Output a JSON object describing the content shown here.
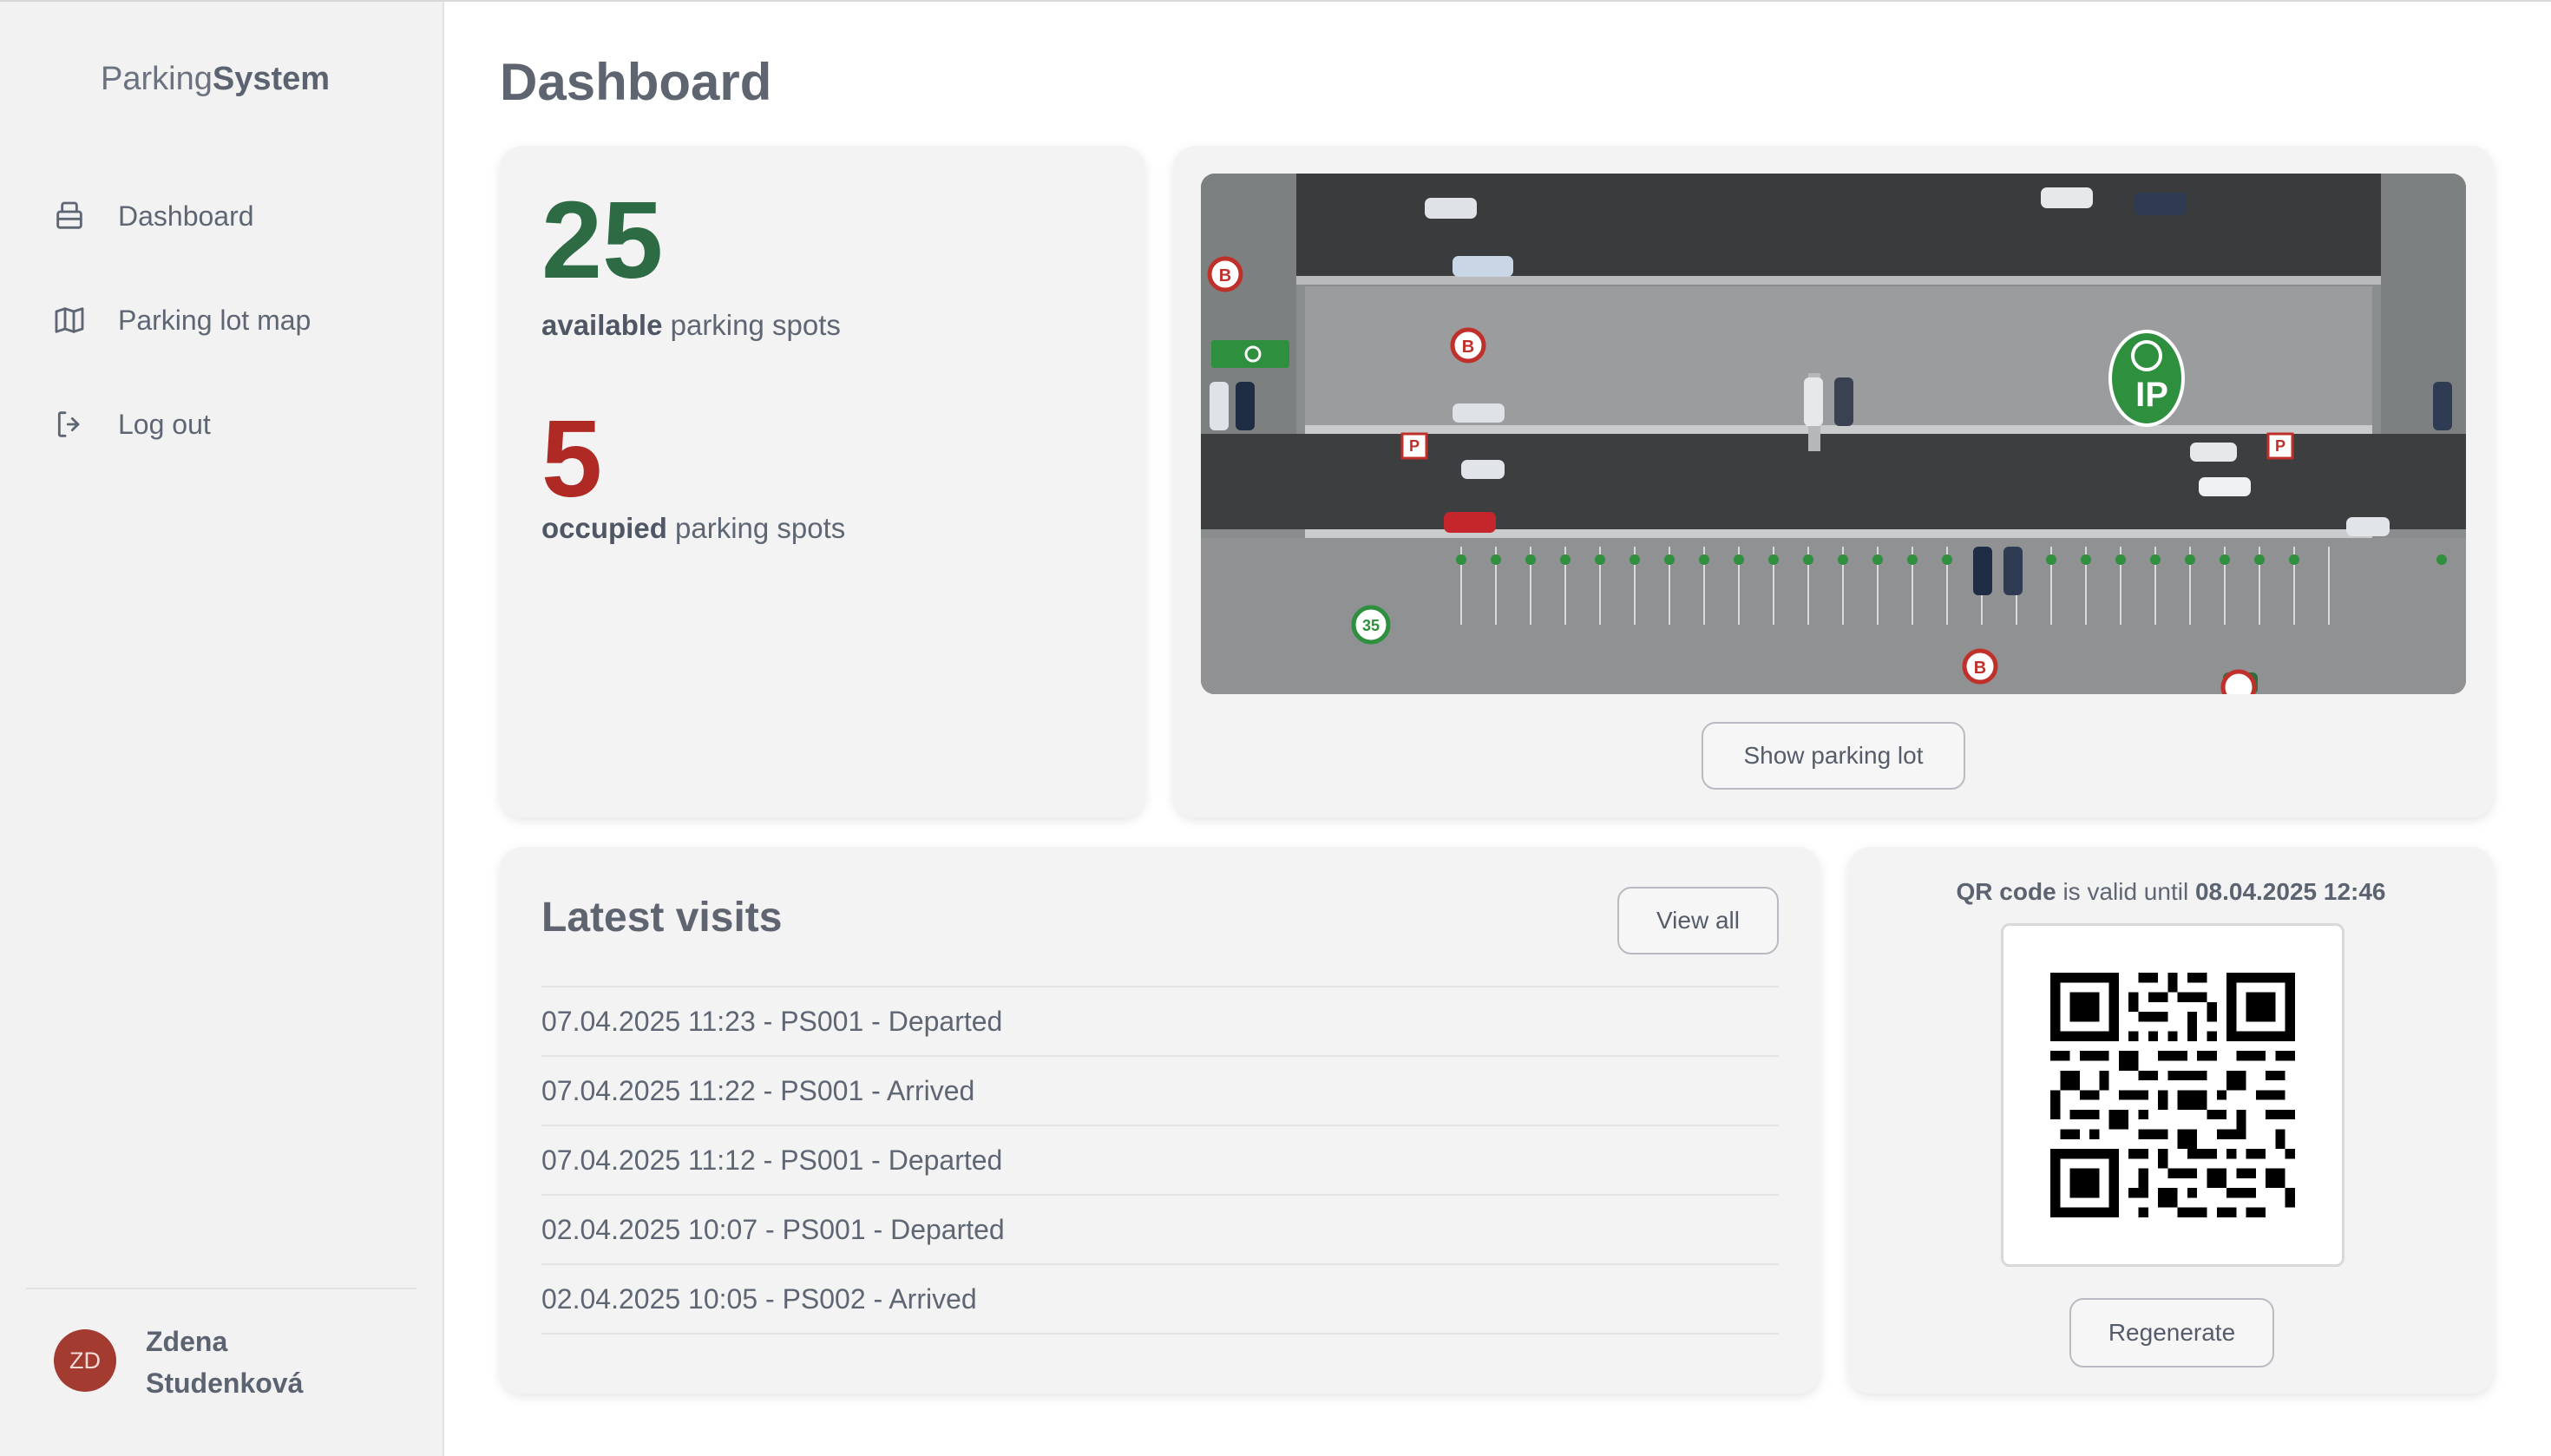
{
  "app": {
    "brand_light": "Parking",
    "brand_bold": "System"
  },
  "sidebar": {
    "items": [
      {
        "label": "Dashboard",
        "icon": "printer-icon"
      },
      {
        "label": "Parking lot map",
        "icon": "map-icon"
      },
      {
        "label": "Log out",
        "icon": "logout-icon"
      }
    ],
    "user": {
      "initials": "ZD",
      "name": "Zdena Studenková"
    }
  },
  "page": {
    "title": "Dashboard"
  },
  "stats": {
    "available_count": "25",
    "available_bold": "available",
    "available_rest": "parking spots",
    "occupied_count": "5",
    "occupied_bold": "occupied",
    "occupied_rest": "parking spots"
  },
  "map": {
    "show_button": "Show parking lot",
    "badge_number": "35",
    "ip_label": "IP"
  },
  "visits": {
    "title": "Latest visits",
    "view_all": "View all",
    "items": [
      "07.04.2025 11:23 - PS001 - Departed",
      "07.04.2025 11:22 - PS001 - Arrived",
      "07.04.2025 11:12 - PS001 - Departed",
      "02.04.2025 10:07 - PS001 - Departed",
      "02.04.2025 10:05 - PS002 - Arrived"
    ]
  },
  "qr": {
    "label_bold": "QR code",
    "label_mid": "is valid until",
    "valid_until": "08.04.2025 12:46",
    "regenerate": "Regenerate"
  },
  "colors": {
    "available": "#2d6b45",
    "occupied": "#b02a25",
    "avatar": "#a33b30",
    "sidebar_bg": "#f2f2f2",
    "card_bg": "#f3f3f3"
  }
}
